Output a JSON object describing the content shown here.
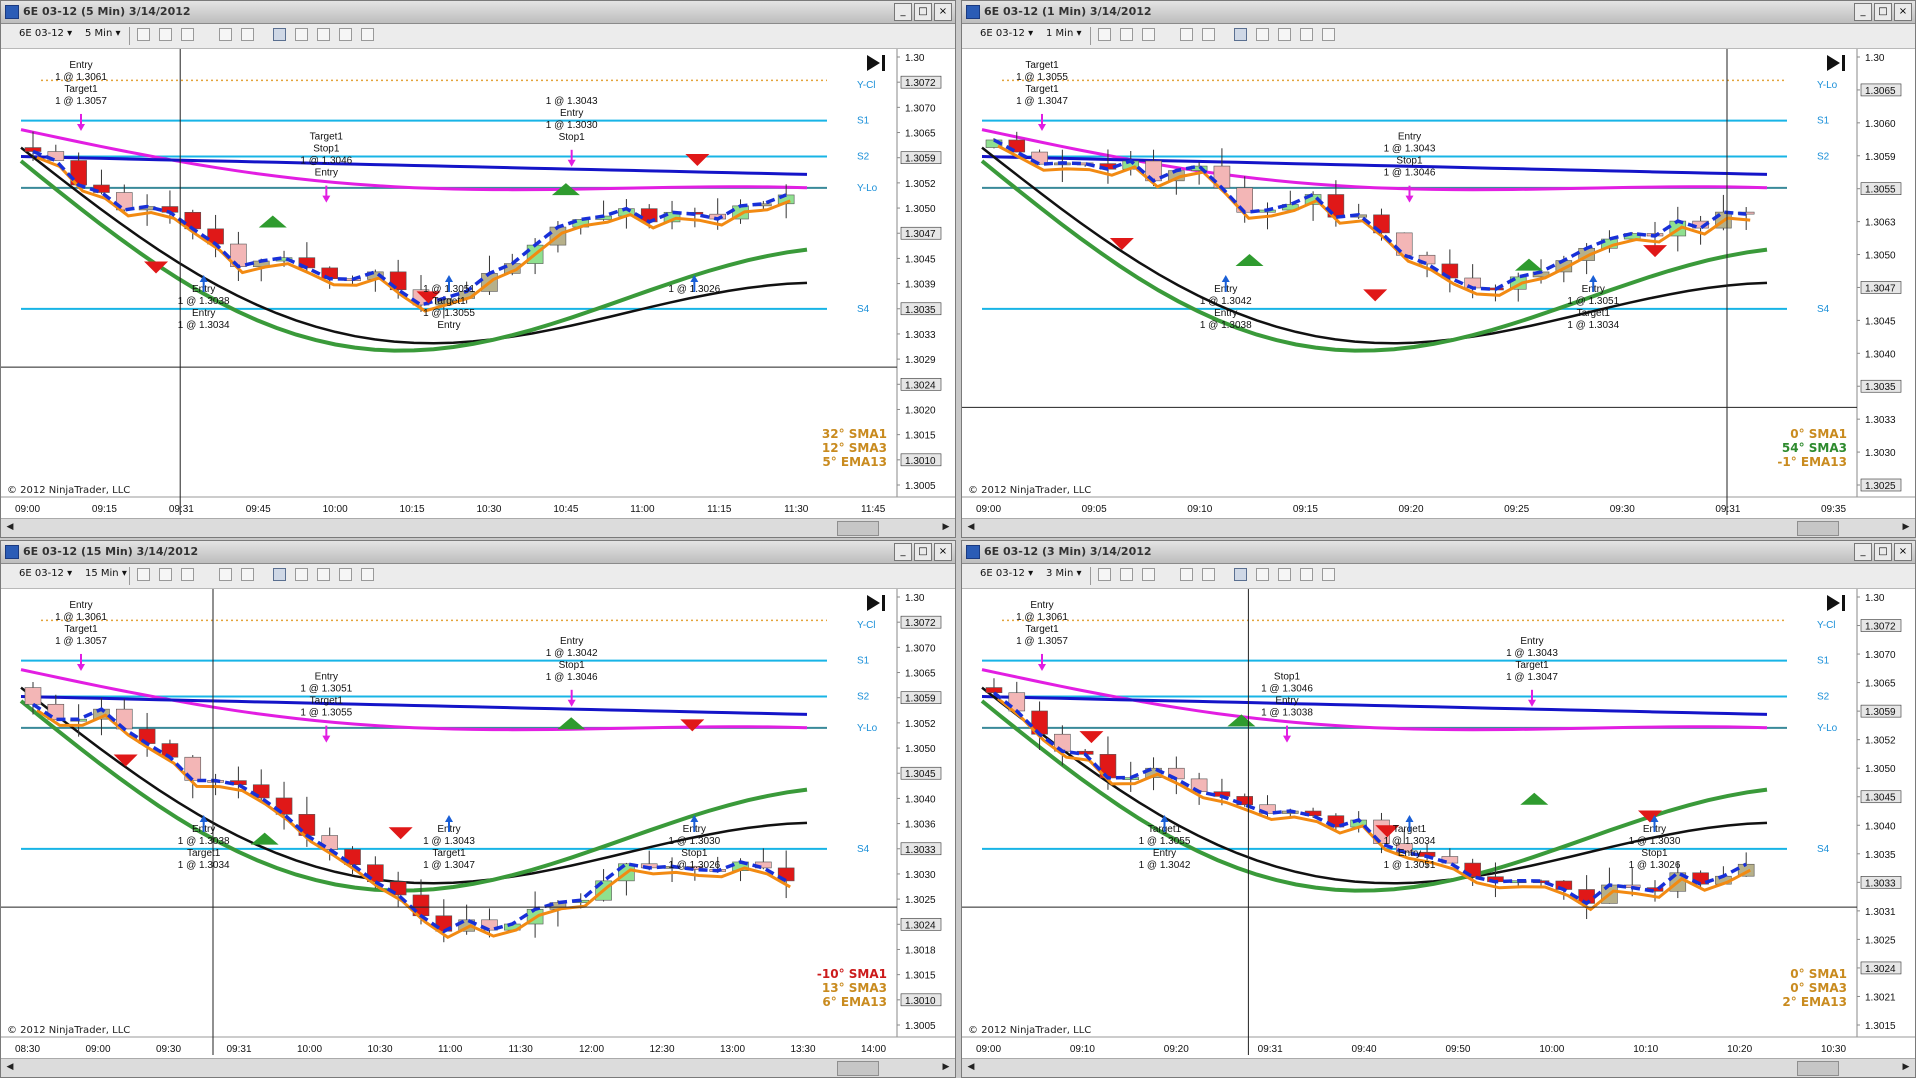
{
  "windows": [
    {
      "title": "6E 03-12 (5 Min)  3/14/2012",
      "instrument": "6E 03-12",
      "interval": "5 Min",
      "copyright": "© 2012 NinjaTrader, LLC",
      "legend": [
        {
          "text": "32° SMA1",
          "color": "#c98b1f"
        },
        {
          "text": "12° SMA3",
          "color": "#c98b1f"
        },
        {
          "text": "5° EMA13",
          "color": "#c98b1f"
        }
      ],
      "price_labels": [
        "1.30",
        "1.3072",
        "1.3070",
        "1.3065",
        "1.3059",
        "1.3052",
        "1.3050",
        "1.3047",
        "1.3045",
        "1.3039",
        "1.3035",
        "1.3033",
        "1.3029",
        "1.3024",
        "1.3020",
        "1.3015",
        "1.3010",
        "1.3005"
      ],
      "time_labels": [
        "09:00",
        "09:15",
        "09:31",
        "09:45",
        "10:00",
        "10:15",
        "10:30",
        "10:45",
        "11:00",
        "11:15",
        "11:30",
        "11:45"
      ],
      "pivot_labels": [
        "S1",
        "S2",
        "S4",
        "Y-Cl",
        "Y-Lo"
      ],
      "annotations": [
        "Entry",
        "1 @ 1.3061",
        "Target1",
        "1 @ 1.3057",
        "Entry",
        "1 @ 1.3038",
        "Entry",
        "1 @ 1.3034",
        "Target1",
        "Stop1",
        "1 @ 1.3046",
        "Entry",
        "1 @ 1.3051",
        "Target1",
        "1 @ 1.3055",
        "Entry",
        "1 @ 1.3043",
        "Entry",
        "1 @ 1.3030",
        "Stop1",
        "1 @ 1.3026"
      ]
    },
    {
      "title": "6E 03-12 (1 Min)  3/14/2012",
      "instrument": "6E 03-12",
      "interval": "1 Min",
      "copyright": "© 2012 NinjaTrader, LLC",
      "legend": [
        {
          "text": "0° SMA1",
          "color": "#c98b1f"
        },
        {
          "text": "54° SMA3",
          "color": "#2e8b2e"
        },
        {
          "text": "-1° EMA13",
          "color": "#c98b1f"
        }
      ],
      "price_labels": [
        "1.30",
        "1.3065",
        "1.3060",
        "1.3059",
        "1.3055",
        "1.3063",
        "1.3050",
        "1.3047",
        "1.3045",
        "1.3040",
        "1.3035",
        "1.3033",
        "1.3030",
        "1.3025"
      ],
      "time_labels": [
        "09:00",
        "09:05",
        "09:10",
        "09:15",
        "09:20",
        "09:25",
        "09:30",
        "09:31",
        "09:35"
      ],
      "pivot_labels": [
        "S1",
        "S2",
        "S4",
        "Y-Lo"
      ],
      "annotations": [
        "Target1",
        "1 @ 1.3055",
        "Target1",
        "1 @ 1.3047",
        "Entry",
        "1 @ 1.3042",
        "Entry",
        "1 @ 1.3038",
        "Entry",
        "1 @ 1.3043",
        "Stop1",
        "1 @ 1.3046",
        "Entry",
        "1 @ 1.3051",
        "Target1",
        "1 @ 1.3034"
      ]
    },
    {
      "title": "6E 03-12 (15 Min)  3/14/2012",
      "instrument": "6E 03-12",
      "interval": "15 Min",
      "copyright": "© 2012 NinjaTrader, LLC",
      "legend": [
        {
          "text": "-10° SMA1",
          "color": "#cc1b1b"
        },
        {
          "text": "13° SMA3",
          "color": "#c98b1f"
        },
        {
          "text": "6° EMA13",
          "color": "#c98b1f"
        }
      ],
      "price_labels": [
        "1.30",
        "1.3072",
        "1.3070",
        "1.3065",
        "1.3059",
        "1.3052",
        "1.3050",
        "1.3045",
        "1.3040",
        "1.3036",
        "1.3033",
        "1.3030",
        "1.3025",
        "1.3024",
        "1.3018",
        "1.3015",
        "1.3010",
        "1.3005"
      ],
      "time_labels": [
        "08:30",
        "09:00",
        "09:30",
        "09:31",
        "10:00",
        "10:30",
        "11:00",
        "11:30",
        "12:00",
        "12:30",
        "13:00",
        "13:30",
        "14:00"
      ],
      "pivot_labels": [
        "S1",
        "S2",
        "S4",
        "Y-Cl",
        "Y-Lo"
      ],
      "annotations": [
        "Entry",
        "1 @ 1.3061",
        "Target1",
        "1 @ 1.3057",
        "Entry",
        "1 @ 1.3038",
        "Target1",
        "1 @ 1.3034",
        "Entry",
        "1 @ 1.3051",
        "Target1",
        "1 @ 1.3055",
        "Entry",
        "1 @ 1.3043",
        "Target1",
        "1 @ 1.3047",
        "Entry",
        "1 @ 1.3042",
        "Stop1",
        "1 @ 1.3046",
        "Entry",
        "1 @ 1.3030",
        "Stop1",
        "1 @ 1.3026"
      ]
    },
    {
      "title": "6E 03-12 (3 Min)  3/14/2012",
      "instrument": "6E 03-12",
      "interval": "3 Min",
      "copyright": "© 2012 NinjaTrader, LLC",
      "legend": [
        {
          "text": "0° SMA1",
          "color": "#c98b1f"
        },
        {
          "text": "0° SMA3",
          "color": "#c98b1f"
        },
        {
          "text": "2° EMA13",
          "color": "#c98b1f"
        }
      ],
      "price_labels": [
        "1.30",
        "1.3072",
        "1.3070",
        "1.3065",
        "1.3059",
        "1.3052",
        "1.3050",
        "1.3045",
        "1.3040",
        "1.3035",
        "1.3033",
        "1.3031",
        "1.3025",
        "1.3024",
        "1.3021",
        "1.3015"
      ],
      "time_labels": [
        "09:00",
        "09:10",
        "09:20",
        "09:31",
        "09:40",
        "09:50",
        "10:00",
        "10:10",
        "10:20",
        "10:30"
      ],
      "pivot_labels": [
        "S1",
        "S2",
        "S4",
        "Y-Cl",
        "Y-Lo"
      ],
      "annotations": [
        "Entry",
        "1 @ 1.3061",
        "Target1",
        "1 @ 1.3057",
        "Target1",
        "1 @ 1.3055",
        "Entry",
        "1 @ 1.3042",
        "Stop1",
        "1 @ 1.3046",
        "Entry",
        "1 @ 1.3038",
        "Target1",
        "1 @ 1.3034",
        "Entry",
        "1 @ 1.3051",
        "Entry",
        "1 @ 1.3043",
        "Target1",
        "1 @ 1.3047",
        "Entry",
        "1 @ 1.3030",
        "Stop1",
        "1 @ 1.3026"
      ]
    }
  ]
}
